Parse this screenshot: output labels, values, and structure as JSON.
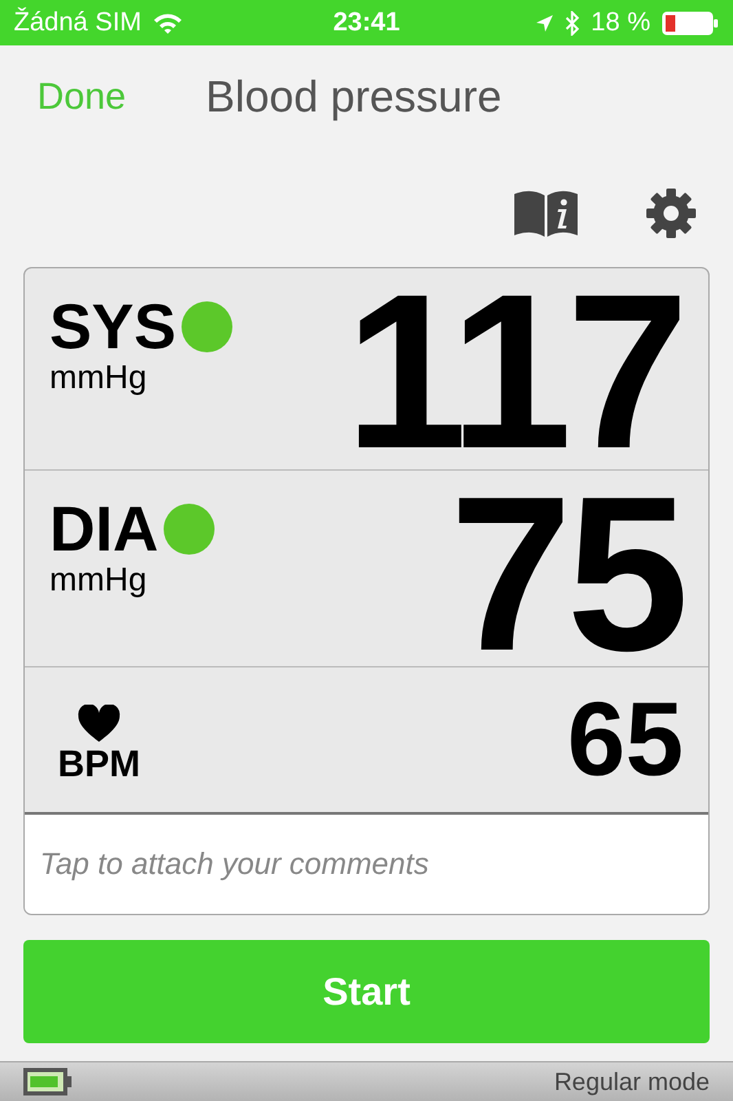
{
  "status_bar": {
    "carrier": "Žádná SIM",
    "time": "23:41",
    "battery": "18 %"
  },
  "nav": {
    "done": "Done",
    "title": "Blood pressure"
  },
  "readings": [
    {
      "kind": "pressure",
      "label": "SYS",
      "unit": "mmHg",
      "value": "117",
      "color": "#5cc82a"
    },
    {
      "kind": "pressure",
      "label": "DIA",
      "unit": "mmHg",
      "value": "75",
      "color": "#5cc82a"
    },
    {
      "kind": "pulse",
      "label": "BPM",
      "value": "65"
    }
  ],
  "comments": {
    "placeholder": "Tap to attach your comments"
  },
  "start_button": "Start",
  "footer": {
    "mode": "Regular mode"
  }
}
